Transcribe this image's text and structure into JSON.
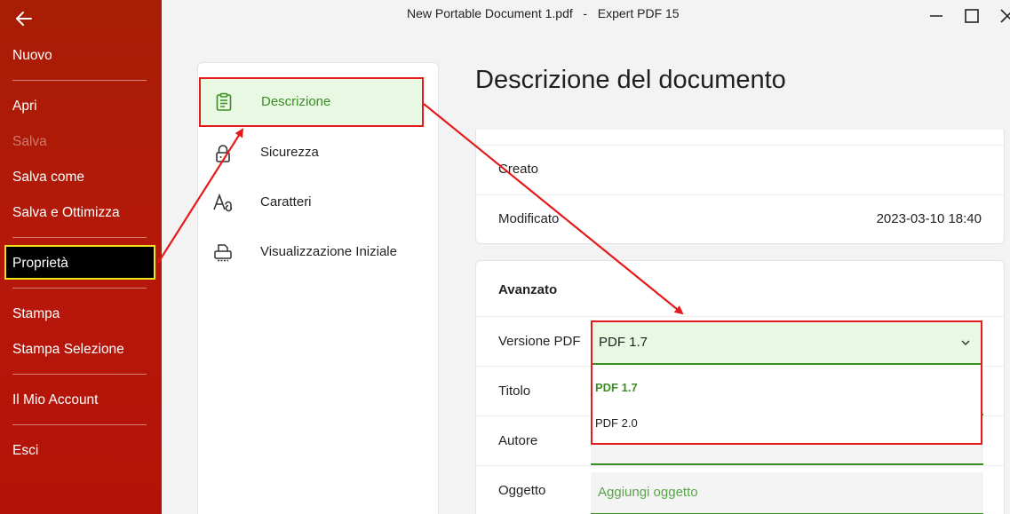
{
  "window": {
    "title": "New Portable Document 1.pdf   -   Expert PDF 15"
  },
  "backstage": {
    "back_icon": "arrow-left-icon",
    "items": [
      {
        "label": "Nuovo"
      },
      {
        "label": "Apri"
      },
      {
        "label": "Salva"
      },
      {
        "label": "Salva come"
      },
      {
        "label": "Salva e Ottimizza"
      },
      {
        "label": "Proprietà"
      },
      {
        "label": "Stampa"
      },
      {
        "label": "Stampa Selezione"
      },
      {
        "label": "Il Mio Account"
      },
      {
        "label": "Esci"
      }
    ]
  },
  "categories": [
    {
      "label": "Descrizione",
      "icon": "clipboard-icon"
    },
    {
      "label": "Sicurezza",
      "icon": "lock-icon"
    },
    {
      "label": "Caratteri",
      "icon": "font-icon"
    },
    {
      "label": "Visualizzazione Iniziale",
      "icon": "printer-icon"
    }
  ],
  "content": {
    "title": "Descrizione del documento",
    "dates": {
      "created_label": "Creato",
      "modified_label": "Modificato",
      "modified_value": "2023-03-10 18:40"
    },
    "advanced": {
      "title": "Avanzato",
      "version_label": "Versione PDF",
      "version_value": "PDF 1.7",
      "version_options": [
        "PDF 1.7",
        "PDF 2.0"
      ],
      "title_label": "Titolo",
      "author_label": "Autore",
      "subject_label": "Oggetto",
      "subject_placeholder": "Aggiungi oggetto"
    }
  },
  "colors": {
    "backstage_red": "#b3170a",
    "accent_green": "#3b8f23",
    "selection_green_bg": "#e8f8e3",
    "annotation_red": "#e51b1b",
    "highlight_yellow": "#f2e31c"
  }
}
